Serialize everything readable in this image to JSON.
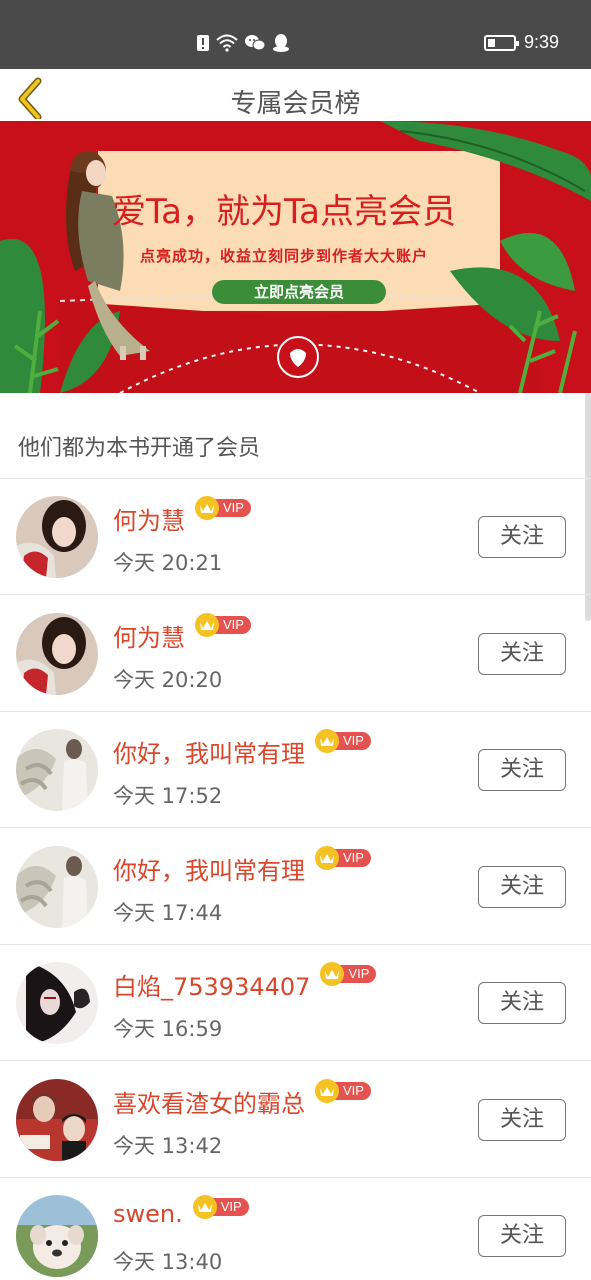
{
  "status_bar": {
    "time": "9:39"
  },
  "header": {
    "title": "专属会员榜"
  },
  "banner": {
    "title": "爱Ta，就为Ta点亮会员",
    "subtitle": "点亮成功，收益立刻同步到作者大大账户",
    "button_label": "立即点亮会员"
  },
  "section": {
    "title": "他们都为本书开通了会员"
  },
  "vip_label": "VIP",
  "follow_label": "关注",
  "members": [
    {
      "name": "何为慧",
      "time": "今天 20:21",
      "avatar": "avatar-girl-icon"
    },
    {
      "name": "何为慧",
      "time": "今天 20:20",
      "avatar": "avatar-girl-icon"
    },
    {
      "name": "你好，我叫常有理",
      "time": "今天 17:52",
      "avatar": "avatar-sweater-icon"
    },
    {
      "name": "你好，我叫常有理",
      "time": "今天 17:44",
      "avatar": "avatar-sweater-icon"
    },
    {
      "name": "白焰_753934407",
      "time": "今天 16:59",
      "avatar": "avatar-dark-icon"
    },
    {
      "name": "喜欢看渣女的霸总",
      "time": "今天 13:42",
      "avatar": "avatar-group-icon"
    },
    {
      "name": "swen.",
      "time": "今天 13:40",
      "avatar": "avatar-puppy-icon"
    }
  ],
  "colors": {
    "status_bar": "#4a4a4a",
    "banner_red": "#c8101a",
    "name_red": "#d9472b",
    "vip_red": "#e4534f",
    "crown_gold": "#f4c223",
    "banner_button_green": "#3b8d3a"
  }
}
